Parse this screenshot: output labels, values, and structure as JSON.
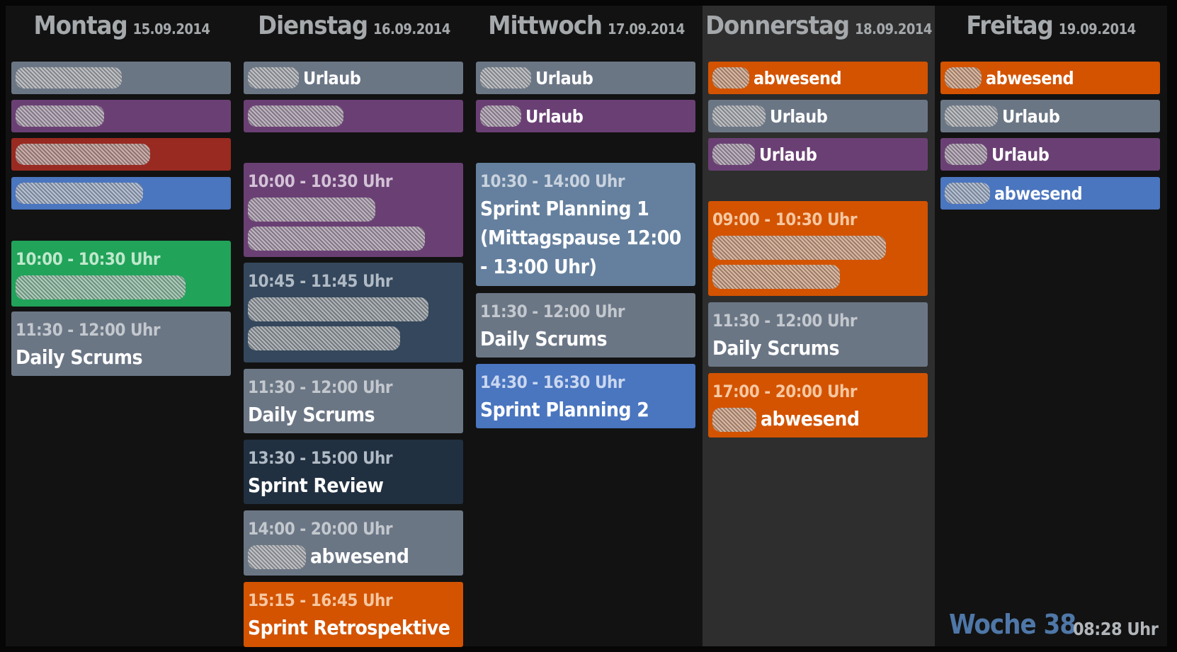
{
  "week_label": "Woche 38",
  "clock": "08:28 Uhr",
  "days": [
    {
      "name": "Montag",
      "date": "15.09.2014"
    },
    {
      "name": "Dienstag",
      "date": "16.09.2014"
    },
    {
      "name": "Mittwoch",
      "date": "17.09.2014"
    },
    {
      "name": "Donnerstag",
      "date": "18.09.2014",
      "today": true
    },
    {
      "name": "Freitag",
      "date": "19.09.2014"
    }
  ],
  "colors": {
    "gray": "#6b7685",
    "purple": "#6a4074",
    "red": "#992a21",
    "blue": "#4a75bf",
    "green": "#21a35a",
    "navy": "#34475c",
    "dark_navy": "#213040",
    "orange": "#d35301",
    "slate": "#65809e",
    "week_accent": "#4f77a8",
    "today_column": "#2e2e2e"
  },
  "events": {
    "mon": {
      "allday_1": {
        "label": ""
      },
      "allday_2": {
        "label": ""
      },
      "allday_3": {
        "label": ""
      },
      "allday_4": {
        "label": ""
      },
      "e1": {
        "time": "10:00 - 10:30 Uhr",
        "title": ""
      },
      "e2": {
        "time": "11:30 - 12:00 Uhr",
        "title": "Daily Scrums"
      }
    },
    "tue": {
      "allday_1": {
        "label": "Urlaub"
      },
      "allday_2": {
        "label": ""
      },
      "e1": {
        "time": "10:00 - 10:30 Uhr",
        "title": ""
      },
      "e2": {
        "time": "10:45 - 11:45 Uhr",
        "title": ""
      },
      "e3": {
        "time": "11:30 - 12:00 Uhr",
        "title": "Daily Scrums"
      },
      "e4": {
        "time": "13:30 - 15:00 Uhr",
        "title": "Sprint Review"
      },
      "e5": {
        "time": "14:00 - 20:00 Uhr",
        "title": "abwesend"
      },
      "e6": {
        "time": "15:15 - 16:45 Uhr",
        "title": "Sprint Retrospektive"
      }
    },
    "wed": {
      "allday_1": {
        "label": "Urlaub"
      },
      "allday_2": {
        "label": "Urlaub"
      },
      "e1": {
        "time": "10:30 - 14:00 Uhr",
        "title": "Sprint Planning 1 (Mittagspause 12:00 - 13:00 Uhr)"
      },
      "e2": {
        "time": "11:30 - 12:00 Uhr",
        "title": "Daily Scrums"
      },
      "e3": {
        "time": "14:30 - 16:30 Uhr",
        "title": "Sprint Planning 2"
      }
    },
    "thu": {
      "allday_1": {
        "label": "abwesend"
      },
      "allday_2": {
        "label": "Urlaub"
      },
      "allday_3": {
        "label": "Urlaub"
      },
      "e1": {
        "time": "09:00 - 10:30 Uhr",
        "title": ""
      },
      "e2": {
        "time": "11:30 - 12:00 Uhr",
        "title": "Daily Scrums"
      },
      "e3": {
        "time": "17:00 - 20:00 Uhr",
        "title": "abwesend"
      }
    },
    "fri": {
      "allday_1": {
        "label": "abwesend"
      },
      "allday_2": {
        "label": "Urlaub"
      },
      "allday_3": {
        "label": "Urlaub"
      },
      "allday_4": {
        "label": "abwesend"
      }
    }
  }
}
